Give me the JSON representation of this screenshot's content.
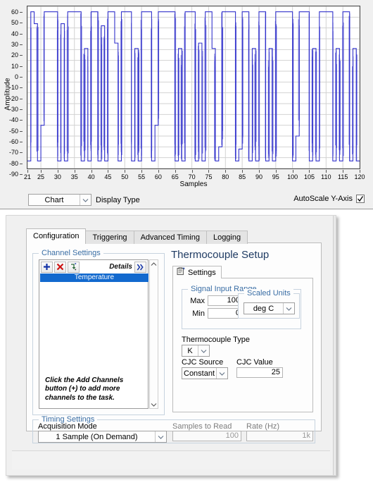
{
  "graph": {
    "ylabel": "Amplitude",
    "xlabel": "Samples",
    "display_type_label": "Display Type",
    "display_type_value": "Chart",
    "autoscale_label": "AutoScale Y-Axis",
    "autoscale_checked": true,
    "trace_color": "#3333cc"
  },
  "chart_data": {
    "type": "line",
    "title": "",
    "xlabel": "Samples",
    "ylabel": "Amplitude",
    "xlim": [
      21,
      120
    ],
    "ylim": [
      -90,
      60
    ],
    "xticks": [
      21,
      25,
      30,
      35,
      40,
      45,
      50,
      55,
      60,
      65,
      70,
      75,
      80,
      85,
      90,
      95,
      100,
      105,
      110,
      115,
      120
    ],
    "yticks": [
      60,
      50,
      40,
      30,
      20,
      10,
      0,
      -10,
      -20,
      -30,
      -40,
      -50,
      -60,
      -70,
      -80,
      -90
    ],
    "grid": true,
    "legend": null,
    "series": [
      {
        "name": "Amplitude",
        "x": [
          21,
          22,
          23,
          24,
          25,
          26,
          27,
          28,
          29,
          30,
          31,
          32,
          33,
          34,
          35,
          36,
          37,
          38,
          39,
          40,
          41,
          42,
          43,
          44,
          45,
          46,
          47,
          48,
          49,
          50,
          51,
          52,
          53,
          54,
          55,
          56,
          57,
          58,
          59,
          60,
          61,
          62,
          63,
          64,
          65,
          66,
          67,
          68,
          69,
          70,
          71,
          72,
          73,
          74,
          75,
          76,
          77,
          78,
          79,
          80,
          81,
          82,
          83,
          84,
          85,
          86,
          87,
          88,
          89,
          90,
          91,
          92,
          93,
          94,
          95,
          96,
          97,
          98,
          99,
          100,
          101,
          102,
          103,
          104,
          105,
          106,
          107,
          108,
          109,
          110,
          111,
          112,
          113,
          114,
          115,
          116,
          117,
          118,
          119,
          120
        ],
        "values": [
          -83,
          55,
          44,
          -83,
          -50,
          55,
          55,
          55,
          55,
          -83,
          44,
          -83,
          55,
          55,
          55,
          55,
          -83,
          21,
          -83,
          55,
          55,
          -83,
          42,
          -83,
          55,
          55,
          26,
          -83,
          55,
          55,
          55,
          -83,
          21,
          -83,
          55,
          55,
          55,
          -83,
          -50,
          55,
          55,
          55,
          55,
          55,
          -83,
          21,
          -83,
          55,
          55,
          55,
          -83,
          26,
          -83,
          55,
          55,
          21,
          -83,
          -70,
          55,
          55,
          55,
          55,
          -83,
          -72,
          55,
          55,
          -83,
          21,
          -83,
          55,
          55,
          -83,
          21,
          -83,
          55,
          55,
          55,
          55,
          55,
          -83,
          -60,
          55,
          55,
          55,
          -83,
          21,
          -83,
          55,
          55,
          55,
          55,
          -83,
          21,
          -83,
          55,
          55,
          -83,
          21,
          -83
        ]
      }
    ]
  },
  "config": {
    "tabs": [
      {
        "label": "Configuration",
        "active": true
      },
      {
        "label": "Triggering",
        "active": false
      },
      {
        "label": "Advanced Timing",
        "active": false
      },
      {
        "label": "Logging",
        "active": false
      }
    ],
    "channel_settings": {
      "group_title": "Channel Settings",
      "toolbar": {
        "add_label": "+",
        "delete_label": "✕",
        "change_label": "change-type",
        "details_label": "Details",
        "expand_label": "»"
      },
      "items": [
        {
          "label": "Temperature",
          "selected": true
        }
      ],
      "hint": "Click the Add Channels button (+) to add more channels to the task."
    },
    "thermocouple": {
      "title": "Thermocouple Setup",
      "settings_tab_label": "Settings",
      "signal_input_range": {
        "group_title": "Signal Input Range",
        "max_label": "Max",
        "max_value": "100",
        "min_label": "Min",
        "min_value": "0"
      },
      "scaled_units": {
        "group_title": "Scaled Units",
        "value": "deg C"
      },
      "tc_type_label": "Thermocouple Type",
      "tc_type_value": "K",
      "cjc_source_label": "CJC Source",
      "cjc_source_value": "Constant",
      "cjc_value_label": "CJC Value",
      "cjc_value": "25"
    },
    "timing_settings": {
      "group_title": "Timing Settings",
      "acquisition_mode_label": "Acquisition Mode",
      "acquisition_mode_value": "1 Sample (On Demand)",
      "samples_to_read_label": "Samples to Read",
      "samples_to_read_value": "100",
      "rate_label": "Rate (Hz)",
      "rate_value": "1k"
    }
  }
}
